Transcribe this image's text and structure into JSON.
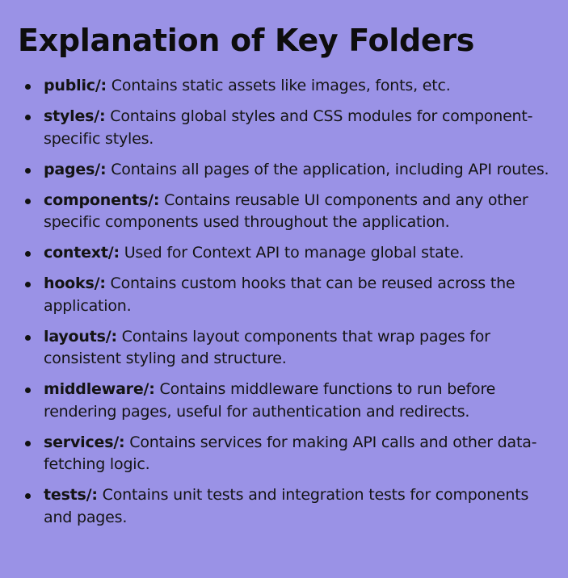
{
  "title": "Explanation of Key Folders",
  "folders": [
    {
      "name": "public/:",
      "description": " Contains static assets like images, fonts, etc."
    },
    {
      "name": "styles/:",
      "description": " Contains global styles and CSS modules for component-specific styles."
    },
    {
      "name": "pages/:",
      "description": " Contains all pages of the application, including API routes."
    },
    {
      "name": "components/:",
      "description": " Contains reusable UI components and any other specific components used throughout the application."
    },
    {
      "name": "context/:",
      "description": " Used for Context API to manage global state."
    },
    {
      "name": "hooks/:",
      "description": " Contains custom hooks that can be reused across the application."
    },
    {
      "name": "layouts/:",
      "description": " Contains layout components that wrap pages for consistent styling and structure."
    },
    {
      "name": "middleware/:",
      "description": " Contains middleware functions to run before rendering pages, useful for authentication and redirects."
    },
    {
      "name": "services/:",
      "description": " Contains services for making API calls and other data-fetching logic."
    },
    {
      "name": "tests/:",
      "description": " Contains unit tests and integration tests for components and pages."
    }
  ]
}
